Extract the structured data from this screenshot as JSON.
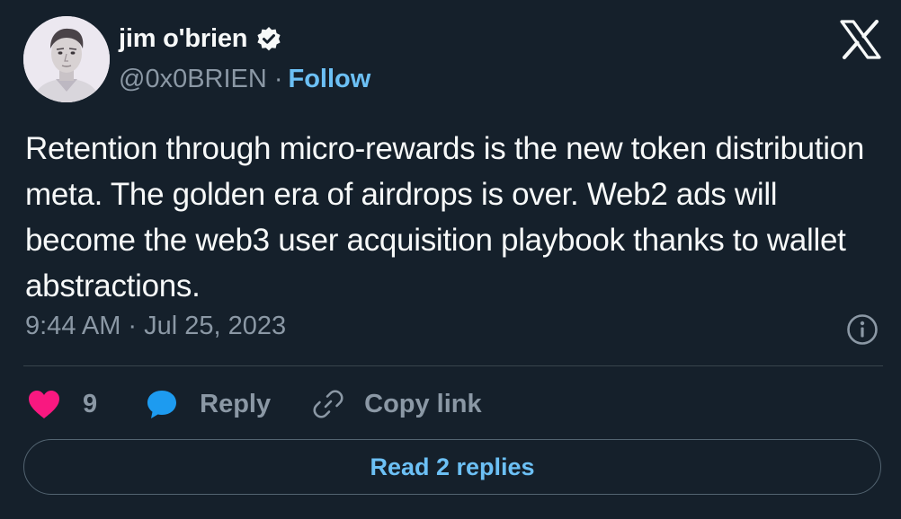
{
  "author": {
    "display_name": "jim o'brien",
    "handle": "@0x0BRIEN",
    "separator": "·",
    "follow_label": "Follow",
    "verified": true
  },
  "icons": {
    "avatar": "avatar",
    "verified": "verified-badge-icon",
    "brand": "x-logo-icon",
    "info": "info-icon",
    "like": "heart-icon",
    "reply": "speech-bubble-icon",
    "copy": "link-icon"
  },
  "tweet": {
    "text": "Retention through micro-rewards is the new token distribution meta. The golden era of airdrops is over. Web2 ads will become the web3 user acquisition playbook thanks to wallet abstractions.",
    "time": "9:44 AM",
    "separator": "·",
    "date": "Jul 25, 2023"
  },
  "actions": {
    "like_count": "9",
    "reply_label": "Reply",
    "copy_link_label": "Copy link"
  },
  "footer": {
    "read_replies_label": "Read 2 replies"
  },
  "colors": {
    "background": "#15202b",
    "text": "#f7f9f9",
    "muted": "#8b98a5",
    "link": "#6cc0f5",
    "like": "#f91880",
    "reply": "#1d9bf0",
    "divider": "#38444d"
  }
}
